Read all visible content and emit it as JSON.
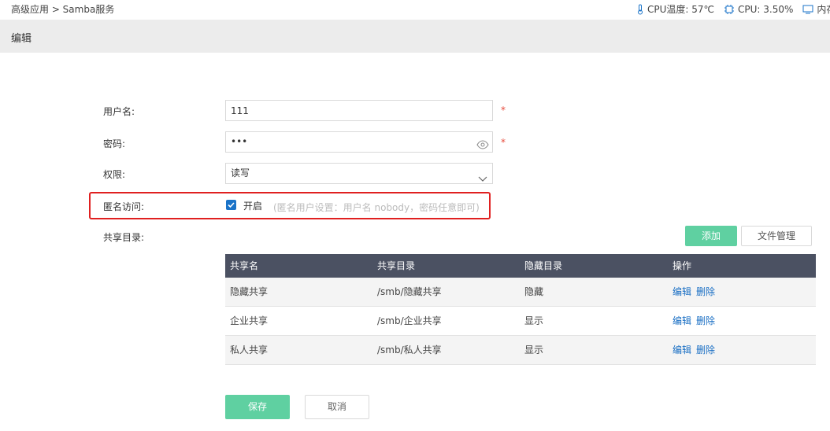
{
  "breadcrumb": "高级应用 > Samba服务",
  "status": {
    "cpu_temp": "CPU温度: 57℃",
    "cpu_usage": "CPU: 3.50%",
    "memory_partial": "内存"
  },
  "header": {
    "title": "编辑"
  },
  "form": {
    "username": {
      "label": "用户名:",
      "value": "111",
      "required_mark": "*"
    },
    "password": {
      "label": "密码:",
      "value": "•••",
      "required_mark": "*"
    },
    "permission": {
      "label": "权限:",
      "value": "读写"
    },
    "anonymous": {
      "label": "匿名访问:",
      "checked": true,
      "option_label": "开启",
      "hint": "(匿名用户设置：用户名 nobody，密码任意即可)"
    },
    "share_dir": {
      "label": "共享目录:"
    }
  },
  "buttons": {
    "add": "添加",
    "file_manage": "文件管理",
    "save": "保存",
    "cancel": "取消"
  },
  "table": {
    "headers": [
      "共享名",
      "共享目录",
      "隐藏目录",
      "操作"
    ],
    "rows": [
      {
        "name": "隐藏共享",
        "path": "/smb/隐藏共享",
        "hidden": "隐藏",
        "edit": "编辑",
        "delete": "删除"
      },
      {
        "name": "企业共享",
        "path": "/smb/企业共享",
        "hidden": "显示",
        "edit": "编辑",
        "delete": "删除"
      },
      {
        "name": "私人共享",
        "path": "/smb/私人共享",
        "hidden": "显示",
        "edit": "编辑",
        "delete": "删除"
      }
    ]
  },
  "colors": {
    "accent_green": "#5fd0a1",
    "table_header": "#4b5162",
    "link_blue": "#1a6fc4",
    "highlight_red": "#e02020",
    "required_red": "#e74c3c"
  },
  "icons": [
    "thermometer-icon",
    "cpu-chip-icon",
    "monitor-icon",
    "eye-icon",
    "chevron-down-icon",
    "check-icon"
  ]
}
